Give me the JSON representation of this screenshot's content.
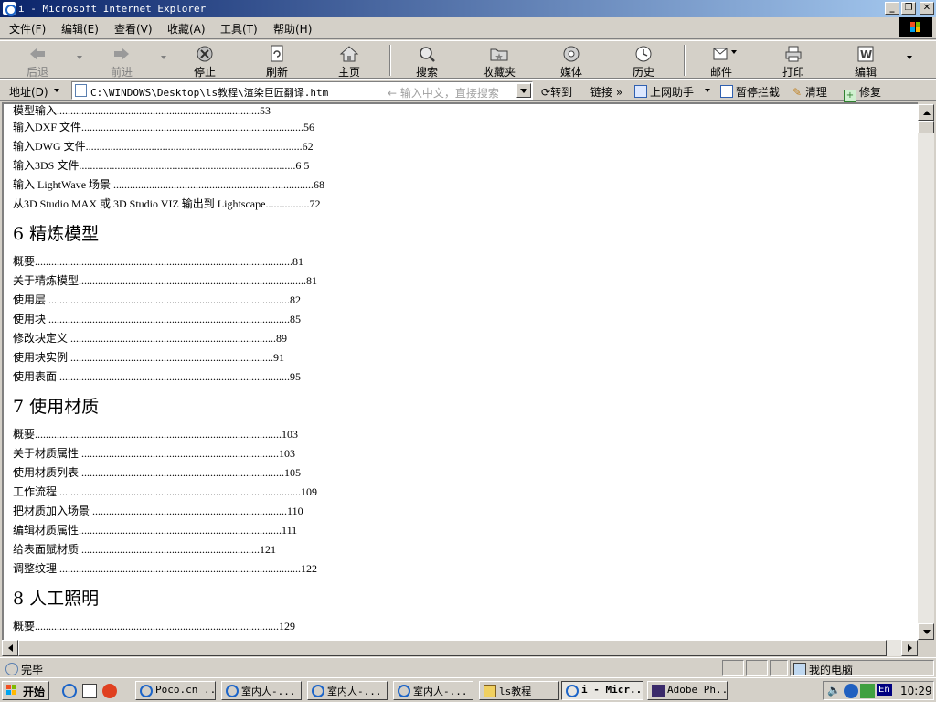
{
  "window": {
    "title": "i - Microsoft Internet Explorer"
  },
  "menu": [
    "文件(F)",
    "编辑(E)",
    "查看(V)",
    "收藏(A)",
    "工具(T)",
    "帮助(H)"
  ],
  "toolbar": {
    "back": "后退",
    "forward": "前进",
    "stop": "停止",
    "refresh": "刷新",
    "home": "主页",
    "search": "搜索",
    "favorites": "收藏夹",
    "media": "媒体",
    "history": "历史",
    "mail": "邮件",
    "print": "打印",
    "edit": "编辑"
  },
  "address": {
    "label": "地址(D)",
    "url": "C:\\WINDOWS\\Desktop\\ls教程\\渲染巨匠翻译.htm",
    "hint": "输入中文，直接搜索",
    "go": "转到",
    "links": "链接",
    "extra": [
      "上网助手",
      "暂停拦截",
      "清理",
      "修复"
    ]
  },
  "toc_top": [
    {
      "title": "模型输入",
      "dots": "..........................................................................",
      "page": "53"
    },
    {
      "title": "输入DXF 文件",
      "dots": ".................................................................................",
      "page": "56"
    },
    {
      "title": "输入DWG 文件",
      "dots": "...............................................................................",
      "page": "62"
    },
    {
      "title": "输入3DS 文件",
      "dots": "...............................................................................",
      "page": "6 5"
    },
    {
      "title": "输入 LightWave 场景",
      "dots": " .........................................................................",
      "page": "68"
    },
    {
      "title": "从3D Studio MAX 或 3D Studio VIZ 输出到 Lightscape",
      "dots": "................",
      "page": "72"
    }
  ],
  "chapters": [
    {
      "heading": "6 精炼模型",
      "items": [
        {
          "title": "概要",
          "dots": "..............................................................................................",
          "page": "81"
        },
        {
          "title": "关于精炼模型",
          "dots": "...................................................................................",
          "page": "81"
        },
        {
          "title": "使用层",
          "dots": " ........................................................................................",
          "page": "82"
        },
        {
          "title": "使用块",
          "dots": " ........................................................................................",
          "page": "85"
        },
        {
          "title": "修改块定义",
          "dots": " ...........................................................................",
          "page": "89"
        },
        {
          "title": "使用块实例",
          "dots": " ..........................................................................",
          "page": "91"
        },
        {
          "title": "使用表面",
          "dots": " ....................................................................................",
          "page": "95"
        }
      ]
    },
    {
      "heading": "7 使用材质",
      "items": [
        {
          "title": "概要",
          "dots": "..........................................................................................",
          "page": "103"
        },
        {
          "title": "关于材质属性",
          "dots": " ........................................................................",
          "page": "103"
        },
        {
          "title": "使用材质列表",
          "dots": " ..........................................................................",
          "page": "105"
        },
        {
          "title": "工作流程",
          "dots": " ........................................................................................",
          "page": "109"
        },
        {
          "title": "把材质加入场景",
          "dots": " .......................................................................",
          "page": "110"
        },
        {
          "title": "编辑材质属性",
          "dots": "..........................................................................",
          "page": "111"
        },
        {
          "title": "给表面赋材质",
          "dots": " .................................................................",
          "page": "121"
        },
        {
          "title": "调整纹理",
          "dots": " ........................................................................................",
          "page": "122"
        }
      ]
    },
    {
      "heading": "8 人工照明",
      "items": [
        {
          "title": "概要",
          "dots": ".........................................................................................",
          "page": "129"
        }
      ]
    }
  ],
  "status": {
    "text": "完毕",
    "zone": "我的电脑"
  },
  "taskbar": {
    "start": "开始",
    "tasks": [
      "Poco.cn ...",
      "室内人-...",
      "室内人-...",
      "室内人-...",
      "ls教程",
      "i - Micr...",
      "Adobe Ph..."
    ],
    "clock": "10:29",
    "ime": "En"
  }
}
